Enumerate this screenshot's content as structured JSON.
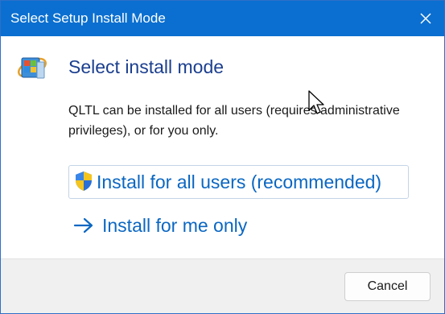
{
  "window": {
    "title": "Select Setup Install Mode"
  },
  "main": {
    "heading": "Select install mode",
    "description": "QLTL can be installed for all users (requires administrative privileges), or for you only.",
    "option_all_users": "Install for all users (recommended)",
    "option_me_only": "Install for me only"
  },
  "footer": {
    "cancel_label": "Cancel"
  },
  "icons": {
    "close": "close-icon",
    "app": "setup-installer-icon",
    "shield": "uac-shield-icon",
    "arrow": "arrow-right-icon",
    "cursor": "mouse-pointer-icon"
  },
  "colors": {
    "titlebar": "#0a6fd0",
    "heading": "#1b3f8f",
    "link": "#0b67c2",
    "footer_bg": "#f0f0f0"
  }
}
